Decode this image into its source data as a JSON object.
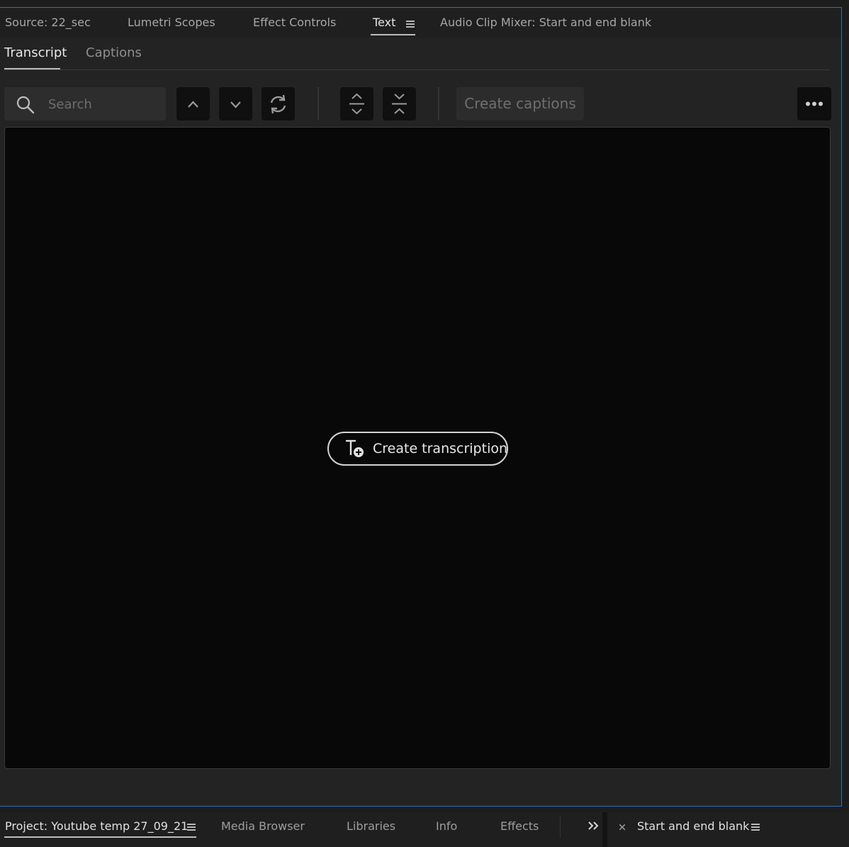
{
  "top_tabs": [
    {
      "label": "Source: 22_sec"
    },
    {
      "label": "Lumetri Scopes"
    },
    {
      "label": "Effect Controls"
    },
    {
      "label": "Text"
    },
    {
      "label": "Audio Clip Mixer: Start and end blank"
    }
  ],
  "sub_tabs": [
    {
      "label": "Transcript"
    },
    {
      "label": "Captions"
    }
  ],
  "toolbar": {
    "search_placeholder": "Search",
    "create_captions": "Create captions",
    "icons": [
      "search-icon",
      "chevron-up-icon",
      "chevron-down-icon",
      "refresh-icon",
      "expand-icon",
      "collapse-icon",
      "more-icon"
    ]
  },
  "main": {
    "create_transcription": "Create transcription"
  },
  "bottom_tabs": [
    {
      "label": "Project: Youtube temp 27_09_21"
    },
    {
      "label": "Media Browser"
    },
    {
      "label": "Libraries"
    },
    {
      "label": "Info"
    },
    {
      "label": "Effects"
    },
    {
      "label": "Start and end blank"
    }
  ],
  "colors": {
    "panel_border": "#2d6fb5",
    "background": "#232323",
    "content": "#080808"
  }
}
